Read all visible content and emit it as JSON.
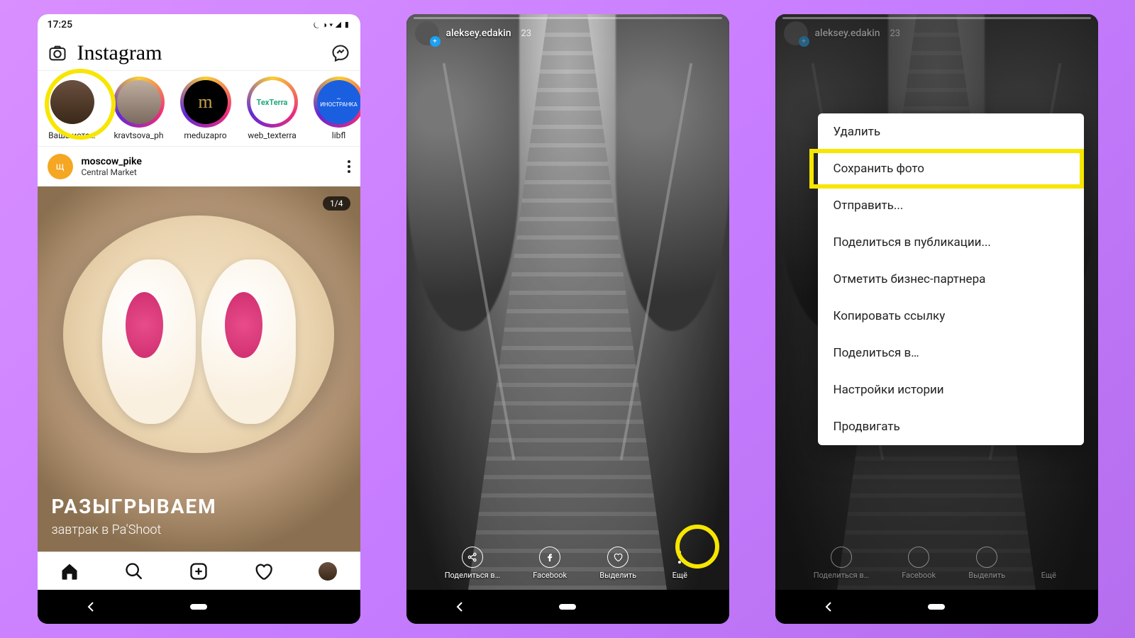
{
  "phone1": {
    "status_time": "17:25",
    "app_logo": "Instagram",
    "stories": [
      {
        "label": "Ваша исто…",
        "ring": "none"
      },
      {
        "label": "kravtsova_ph",
        "ring": "gradient"
      },
      {
        "label": "meduzapro",
        "ring": "gradient",
        "style": "black",
        "text": "m"
      },
      {
        "label": "web_texterra",
        "ring": "gradient",
        "style": "white",
        "text": "TexTerra"
      },
      {
        "label": "libfl",
        "ring": "gradient",
        "style": "blue",
        "text": "~\nИНОСТРАНКА"
      }
    ],
    "post": {
      "user": "moscow_pike",
      "location": "Central Market",
      "pager": "1/4",
      "cap_title": "РАЗЫГРЫВАЕМ",
      "cap_sub": "завтрак в Pa'Shoot"
    }
  },
  "phone2": {
    "user": "aleksey.edakin",
    "time_ago": "23",
    "actions": {
      "share": "Поделиться в…",
      "facebook": "Facebook",
      "highlight": "Выделить",
      "more": "Ещё"
    }
  },
  "phone3": {
    "user": "aleksey.edakin",
    "time_ago": "23",
    "actions": {
      "share": "Поделиться в…",
      "facebook": "Facebook",
      "highlight": "Выделить",
      "more": "Ещё"
    },
    "menu": [
      "Удалить",
      "Сохранить фото",
      "Отправить...",
      "Поделиться в публикации...",
      "Отметить бизнес-партнера",
      "Копировать ссылку",
      "Поделиться в…",
      "Настройки истории",
      "Продвигать"
    ],
    "menu_highlight_index": 1
  }
}
